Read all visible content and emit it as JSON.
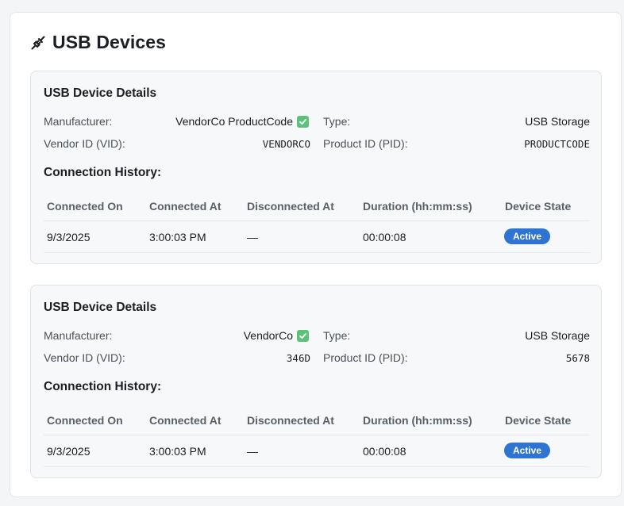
{
  "page": {
    "title": "USB Devices",
    "icon": "plug-icon"
  },
  "devices": [
    {
      "card_title": "USB Device Details",
      "manufacturer_label": "Manufacturer:",
      "manufacturer_value": "VendorCo ProductCode",
      "manufacturer_verified": true,
      "type_label": "Type:",
      "type_value": "USB Storage",
      "vid_label": "Vendor ID (VID):",
      "vid_value": "VENDORCO",
      "pid_label": "Product ID (PID):",
      "pid_value": "PRODUCTCODE",
      "history_title": "Connection History:",
      "history_columns": [
        "Connected On",
        "Connected At",
        "Disconnected At",
        "Duration (hh:mm:ss)",
        "Device State"
      ],
      "history_rows": [
        {
          "connected_on": "9/3/2025",
          "connected_at": "3:00:03 PM",
          "disconnected_at": "—",
          "duration": "00:00:08",
          "state": "Active"
        }
      ]
    },
    {
      "card_title": "USB Device Details",
      "manufacturer_label": "Manufacturer:",
      "manufacturer_value": "VendorCo",
      "manufacturer_verified": true,
      "type_label": "Type:",
      "type_value": "USB Storage",
      "vid_label": "Vendor ID (VID):",
      "vid_value": "346D",
      "pid_label": "Product ID (PID):",
      "pid_value": "5678",
      "history_title": "Connection History:",
      "history_columns": [
        "Connected On",
        "Connected At",
        "Disconnected At",
        "Duration (hh:mm:ss)",
        "Device State"
      ],
      "history_rows": [
        {
          "connected_on": "9/3/2025",
          "connected_at": "3:00:03 PM",
          "disconnected_at": "—",
          "duration": "00:00:08",
          "state": "Active"
        }
      ]
    }
  ],
  "colors": {
    "badge_active": "#2f74d0",
    "verified_check": "#5cc27a",
    "card_background": "#f7f8fa"
  }
}
